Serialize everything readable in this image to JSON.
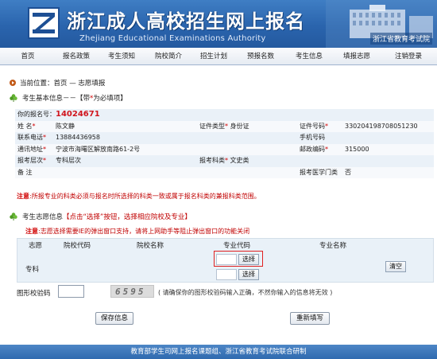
{
  "header": {
    "title": "浙江成人高校招生网上报名",
    "subtitle": "Zhejiang Educational Examinations Authority",
    "org": "浙江省教育考试院"
  },
  "nav": {
    "items": [
      "首页",
      "报名政策",
      "考生须知",
      "院校简介",
      "招生计划",
      "预报名数",
      "考生信息",
      "填报志愿",
      "注销登录"
    ]
  },
  "breadcrumb": "当前位置：首页 — 志愿填报",
  "basic_info": {
    "title": "考生基本信息－－【带",
    "title_star": "*",
    "title_tail": "为必填项】",
    "regno_label": "你的报名号：",
    "regno": "14024671",
    "name_label": "姓 名",
    "name": "陈文静",
    "idtype_label": "证件类型",
    "idtype": "身份证",
    "idno_label": "证件号码",
    "idno": "330204198708051230",
    "phone_label": "联系电话",
    "phone": "13884436958",
    "mobile_label": "手机号码",
    "mobile": "",
    "address_label": "通讯地址",
    "address": "宁波市海曙区解放南路61-2号",
    "zip_label": "邮政编码",
    "zip": "315000",
    "level_label": "报考层次",
    "level": "专科层次",
    "subject_label": "报考科类",
    "subject": "文史类",
    "remark_label": "备 注",
    "remark": "",
    "medical_label": "报考医学门类",
    "medical": "否",
    "star": "*"
  },
  "notice": {
    "label": "注意",
    "text": ":所报专业的科类必须与报名时所选择的科类一致或属于报名科类的兼报科类范围。"
  },
  "choice": {
    "title": "考生志愿信息",
    "instruction": "【点击“选择”按钮，选择相应院校及专业】",
    "warn_label": "注意",
    "warn_text": ":志愿选择需要IE的弹出窗口支持，请将上网助手等阻止弹出窗口的功能关闭",
    "headers": [
      "志愿",
      "院校代码",
      "院校名称",
      "专业代码",
      "专业名称"
    ],
    "level": "专科",
    "select_label": "选择",
    "clear_label": "清空"
  },
  "captcha": {
    "label": "图形校验码",
    "value": "",
    "image_text": "6595",
    "hint": "( 请确保你的图形校验码输入正确，不然你输入的信息将无效 )"
  },
  "buttons": {
    "save": "保存信息",
    "reset": "重新填写"
  },
  "footer": "教育部学生司网上报名课题组、浙江省教育考试院联合研制",
  "colors": {
    "banner": "#2a64ad",
    "accent_red": "#d00000",
    "row_light": "#eaf1f8",
    "footer": "#2f6aaf"
  }
}
